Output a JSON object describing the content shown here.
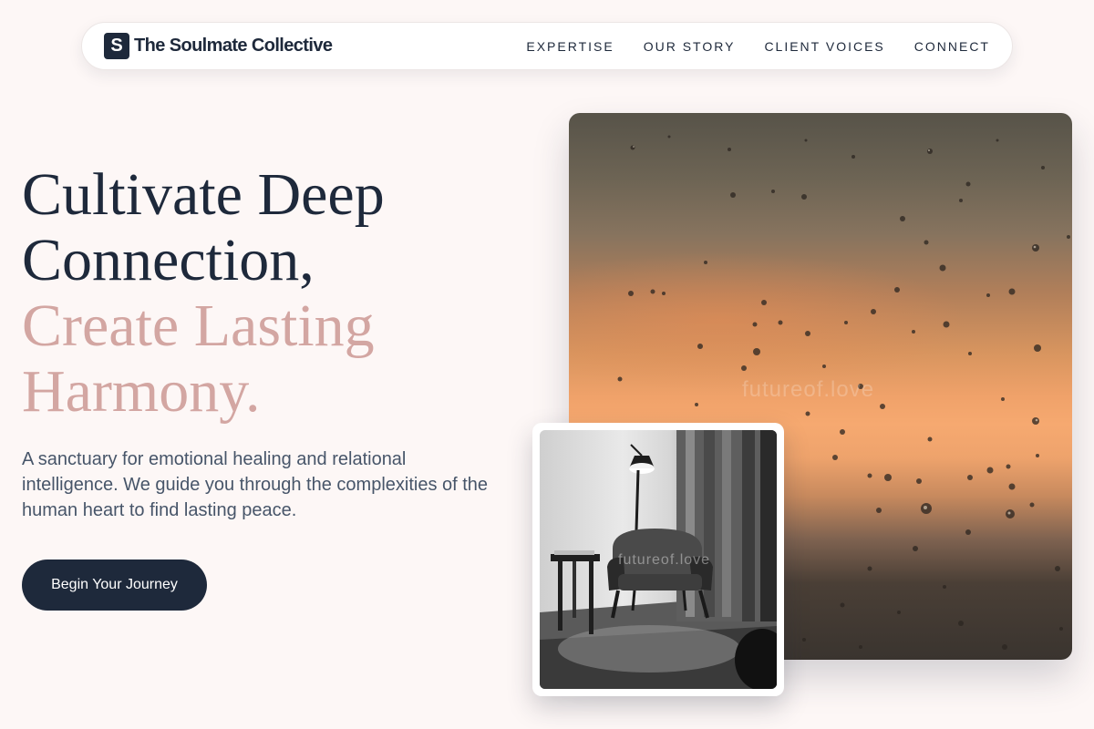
{
  "brand": {
    "mark": "S",
    "name": "The Soulmate Collective"
  },
  "nav": {
    "links": [
      "EXPERTISE",
      "OUR STORY",
      "CLIENT VOICES",
      "CONNECT"
    ]
  },
  "hero": {
    "headline_line1": "Cultivate Deep",
    "headline_line2": "Connection,",
    "headline_line3": "Create Lasting",
    "headline_line4": "Harmony.",
    "subtitle": "A sanctuary for emotional healing and relational intelligence. We guide you through the complexities of the human heart to find lasting peace.",
    "cta_label": "Begin Your Journey"
  },
  "images": {
    "main_watermark": "futureof.love",
    "inset_watermark": "futureof.love"
  },
  "colors": {
    "primary": "#1e293b",
    "accent_rose": "#d3a6a2",
    "background": "#fdf7f6",
    "body_text": "#475569"
  }
}
